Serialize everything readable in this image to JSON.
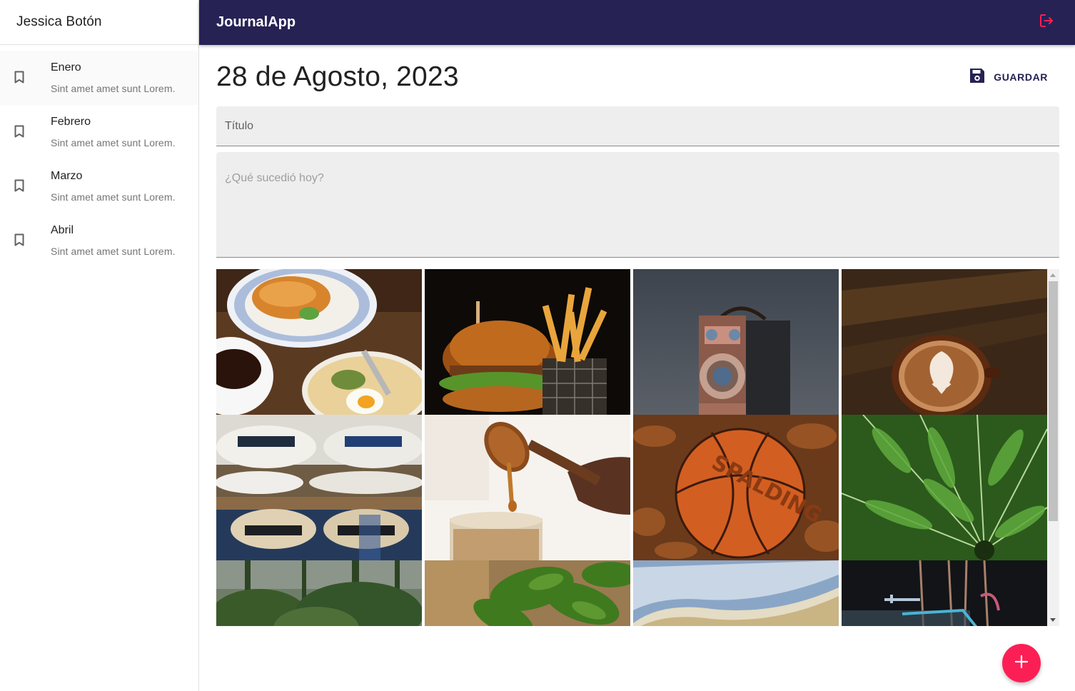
{
  "sidebar": {
    "user_name": "Jessica Botón",
    "entries": [
      {
        "title": "Enero",
        "subtitle": "Sint amet amet sunt Lorem.",
        "icon": "bookmark-icon"
      },
      {
        "title": "Febrero",
        "subtitle": "Sint amet amet sunt Lorem.",
        "icon": "bookmark-icon"
      },
      {
        "title": "Marzo",
        "subtitle": "Sint amet amet sunt Lorem.",
        "icon": "bookmark-icon"
      },
      {
        "title": "Abril",
        "subtitle": "Sint amet amet sunt Lorem.",
        "icon": "bookmark-icon"
      }
    ]
  },
  "appbar": {
    "title": "JournalApp",
    "logout_icon": "logout-icon"
  },
  "note": {
    "date": "28 de Agosto, 2023",
    "save_label": "GUARDAR",
    "title_placeholder": "Título",
    "body_placeholder": "¿Qué sucedió hoy?"
  },
  "gallery": {
    "images": [
      "breakfast-croissant-photo",
      "burger-fries-photo",
      "vintage-camera-photo",
      "latte-art-coffee-photo",
      "straw-hats-photo",
      "honey-dipper-photo",
      "spalding-basketball-photo",
      "fern-leaf-photo",
      "forest-trees-photo",
      "basil-leaves-photo",
      "beach-wave-sand-photo",
      "bicycle-photo"
    ]
  },
  "fab": {
    "icon": "plus-icon"
  },
  "colors": {
    "appbar": "#262254",
    "accent": "#fc1f55",
    "save_text": "#262254"
  }
}
